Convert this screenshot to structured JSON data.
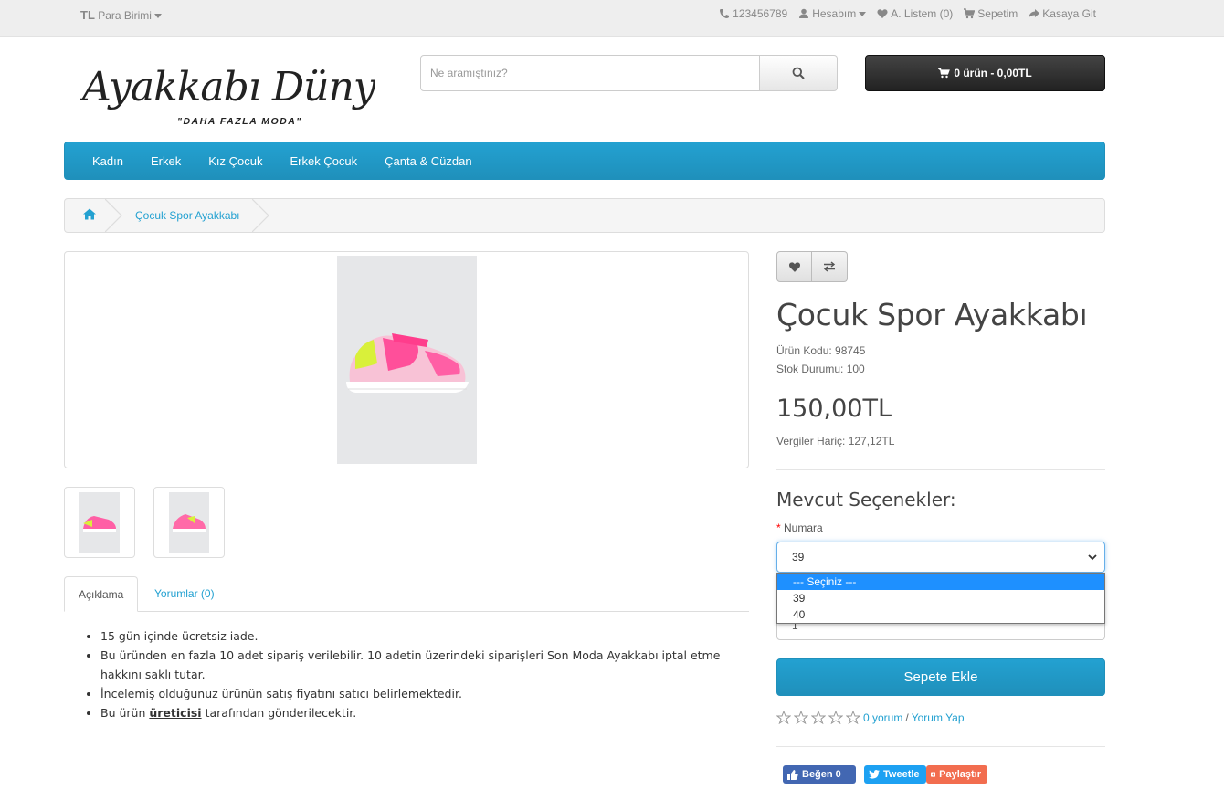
{
  "topbar": {
    "currency_symbol": "TL",
    "currency_label": "Para Birimi",
    "phone": "123456789",
    "account": "Hesabım",
    "wishlist": "A. Listem (0)",
    "cart": "Sepetim",
    "checkout": "Kasaya Git"
  },
  "logo": {
    "name": "Ayakkabı Dünyası",
    "slogan": "\"DAHA FAZLA MODA\""
  },
  "search": {
    "placeholder": "Ne aramıştınız?"
  },
  "cart_button": {
    "label": "0 ürün - 0,00TL"
  },
  "nav": {
    "items": [
      "Kadın",
      "Erkek",
      "Kız Çocuk",
      "Erkek Çocuk",
      "Çanta & Cüzdan"
    ]
  },
  "breadcrumb": {
    "current": "Çocuk Spor Ayakkabı"
  },
  "tabs": {
    "description": "Açıklama",
    "reviews": "Yorumlar (0)"
  },
  "description": {
    "items": [
      "15 gün içinde ücretsiz iade.",
      "Bu üründen en fazla 10 adet sipariş verilebilir. 10 adetin üzerindeki siparişleri Son Moda Ayakkabı iptal etme hakkını saklı tutar.",
      "İncelemiş olduğunuz ürünün satış fiyatını satıcı belirlemektedir."
    ],
    "last_prefix": "Bu ürün ",
    "last_bold": "üreticisi",
    "last_suffix": " tarafından gönderilecektir."
  },
  "product": {
    "title": "Çocuk Spor Ayakkabı",
    "code": "Ürün Kodu: 98745",
    "stock": "Stok Durumu: 100",
    "price": "150,00TL",
    "ex_tax": "Vergiler Hariç: 127,12TL"
  },
  "options": {
    "heading": "Mevcut Seçenekler:",
    "required_mark": "*",
    "size_label": "Numara",
    "selected_value": "39",
    "dropdown": [
      "--- Seçiniz ---",
      "39",
      "40"
    ],
    "qty_value": "1"
  },
  "add_to_cart": "Sepete Ekle",
  "rating": {
    "reviews_link": "0 yorum",
    "separator": "/",
    "write_link": "Yorum Yap",
    "stars": 0
  },
  "social": {
    "like": "Beğen 0",
    "tweet": "Tweetle",
    "share": "Paylaştır"
  },
  "colors": {
    "accent": "#23a1d1",
    "dark": "#222222",
    "facebook": "#4267b2",
    "twitter": "#1da1f2",
    "share": "#f26d4f"
  }
}
